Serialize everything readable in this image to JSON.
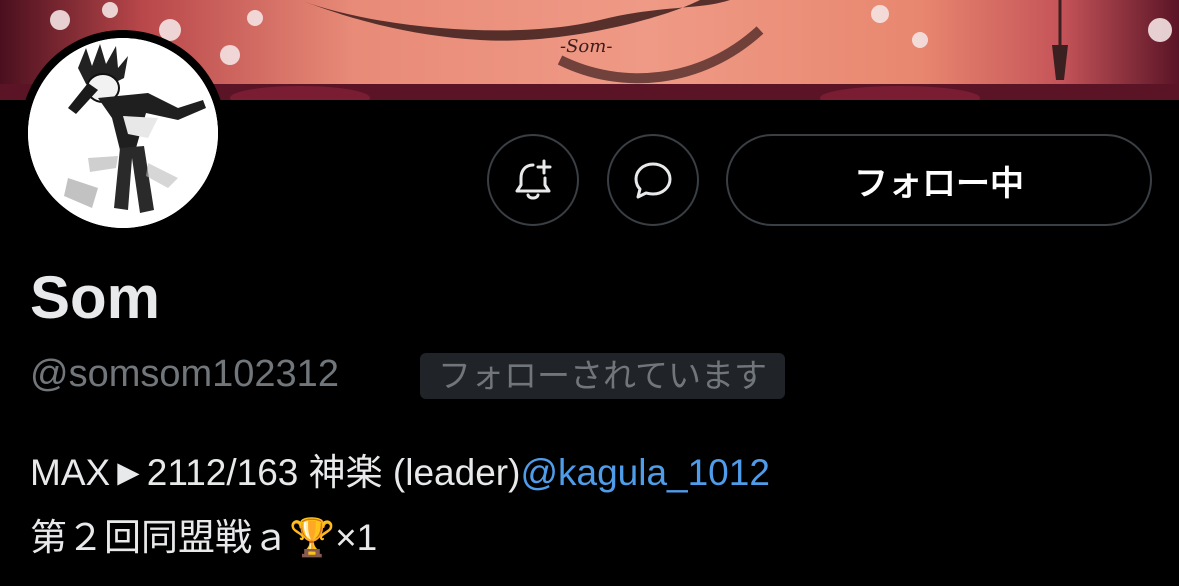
{
  "profile": {
    "display_name": "Som",
    "handle": "@somsom102312",
    "follows_you_badge": "フォローされています",
    "banner_signature": "-Som-"
  },
  "actions": {
    "notify_icon": "bell-plus-icon",
    "message_icon": "chat-bubble-icon",
    "follow_label": "フォロー中"
  },
  "bio": {
    "line1_text": "MAX►2112/163 神楽 (leader)",
    "line1_mention": "@kagula_1012",
    "line2_text": "第２回同盟戦ａ",
    "line2_trophy": "🏆",
    "line2_suffix": "×1"
  },
  "colors": {
    "background": "#000000",
    "text_primary": "#e7e9ea",
    "text_secondary": "#71767b",
    "link": "#4f9dea",
    "button_border": "#3a3f44",
    "badge_bg": "#202327"
  }
}
